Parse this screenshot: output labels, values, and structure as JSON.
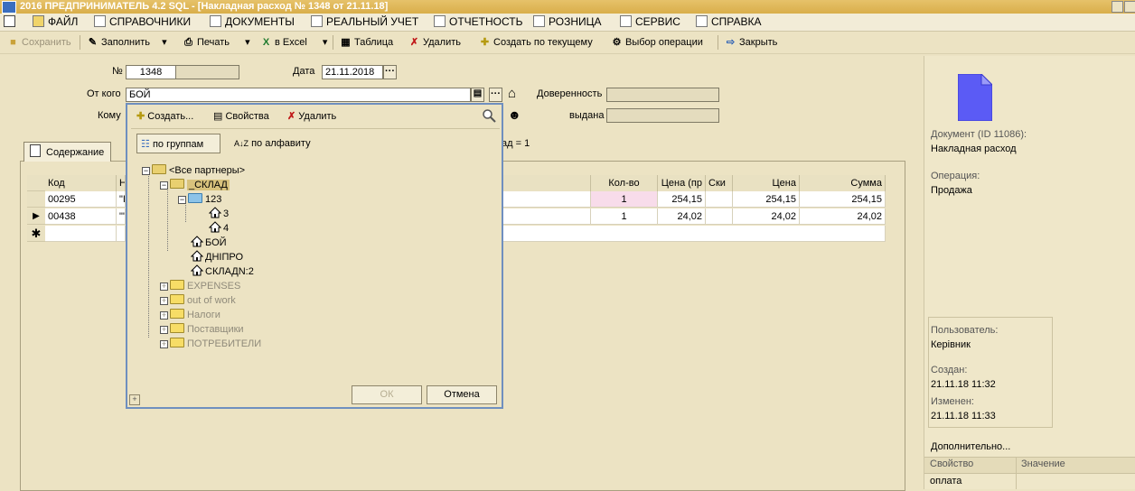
{
  "window": {
    "title": "2016  ПРЕДПРИНИМАТЕЛЬ 4.2 SQL - [Накладная расход № 1348 от 21.11.18]"
  },
  "menu": {
    "items": [
      {
        "label": "ФАЙЛ"
      },
      {
        "label": "СПРАВОЧНИКИ"
      },
      {
        "label": "ДОКУМЕНТЫ"
      },
      {
        "label": "РЕАЛЬНЫЙ УЧЕТ"
      },
      {
        "label": "ОТЧЕТНОСТЬ"
      },
      {
        "label": "РОЗНИЦА"
      },
      {
        "label": "СЕРВИС"
      },
      {
        "label": "СПРАВКА"
      }
    ]
  },
  "toolbar": {
    "save": "Сохранить",
    "fill": "Заполнить",
    "print": "Печать",
    "excel": "в Excel",
    "table": "Таблица",
    "delete": "Удалить",
    "create_from": "Создать по текущему",
    "choose_op": "Выбор операции",
    "close": "Закрыть"
  },
  "form": {
    "number_label": "№",
    "number_value": "1348",
    "date_label": "Дата",
    "date_value": "21.11.2018",
    "from_label": "От кого",
    "from_value": "БОЙ",
    "to_label": "Кому",
    "proxy_label": "Доверенность",
    "issued_label": "выдана",
    "summary_fragment": "ад = 1"
  },
  "tabs": {
    "content": "Содержание"
  },
  "grid": {
    "headers": [
      "Код",
      "Н",
      "Кол-во",
      "Цена (пр",
      "Ски",
      "Цена",
      "Сумма"
    ],
    "rows": [
      {
        "code": "00295",
        "name": "\"I",
        "qty": "1",
        "price1": "254,15",
        "disc": "",
        "price": "254,15",
        "sum": "254,15"
      },
      {
        "code": "00438",
        "name": "\"'",
        "qty": "1",
        "price1": "24,02",
        "disc": "",
        "price": "24,02",
        "sum": "24,02"
      }
    ]
  },
  "popup": {
    "create": "Создать...",
    "properties": "Свойства",
    "delete": "Удалить",
    "tab_groups": "по группам",
    "tab_alpha": "по алфавиту",
    "tree": {
      "root": "<Все партнеры>",
      "sklad": "_СКЛАД",
      "g123": "123",
      "n3": "3",
      "n4": "4",
      "boy": "БОЙ",
      "dnipro": "ДНІПРО",
      "sklad2": "СКЛАДN:2",
      "expenses": "EXPENSES",
      "outofwork": "out of work",
      "nalogi": "Налоги",
      "postav": "Поставщики",
      "potreb": "ПОТРЕБИТЕЛИ"
    },
    "ok": "ОК",
    "cancel": "Отмена"
  },
  "right_panel": {
    "doc_label": "Документ  (ID 11086):",
    "doc_value": "Накладная расход",
    "op_label": "Операция:",
    "op_value": "Продажа",
    "user_label": "Пользователь:",
    "user_value": "Керівник",
    "created_label": "Создан:",
    "created_value": "21.11.18  11:32",
    "changed_label": "Изменен:",
    "changed_value": "21.11.18  11:33",
    "extra": "Дополнительно...",
    "prop_header": "Свойство",
    "value_header": "Значение",
    "prop_row": "оплата"
  },
  "colors": {
    "titlebar": "#d9ae4a",
    "popup_border": "#6f8fbf",
    "doc_icon": "#5b5bf5",
    "qty_cell": "#f8dcea"
  }
}
